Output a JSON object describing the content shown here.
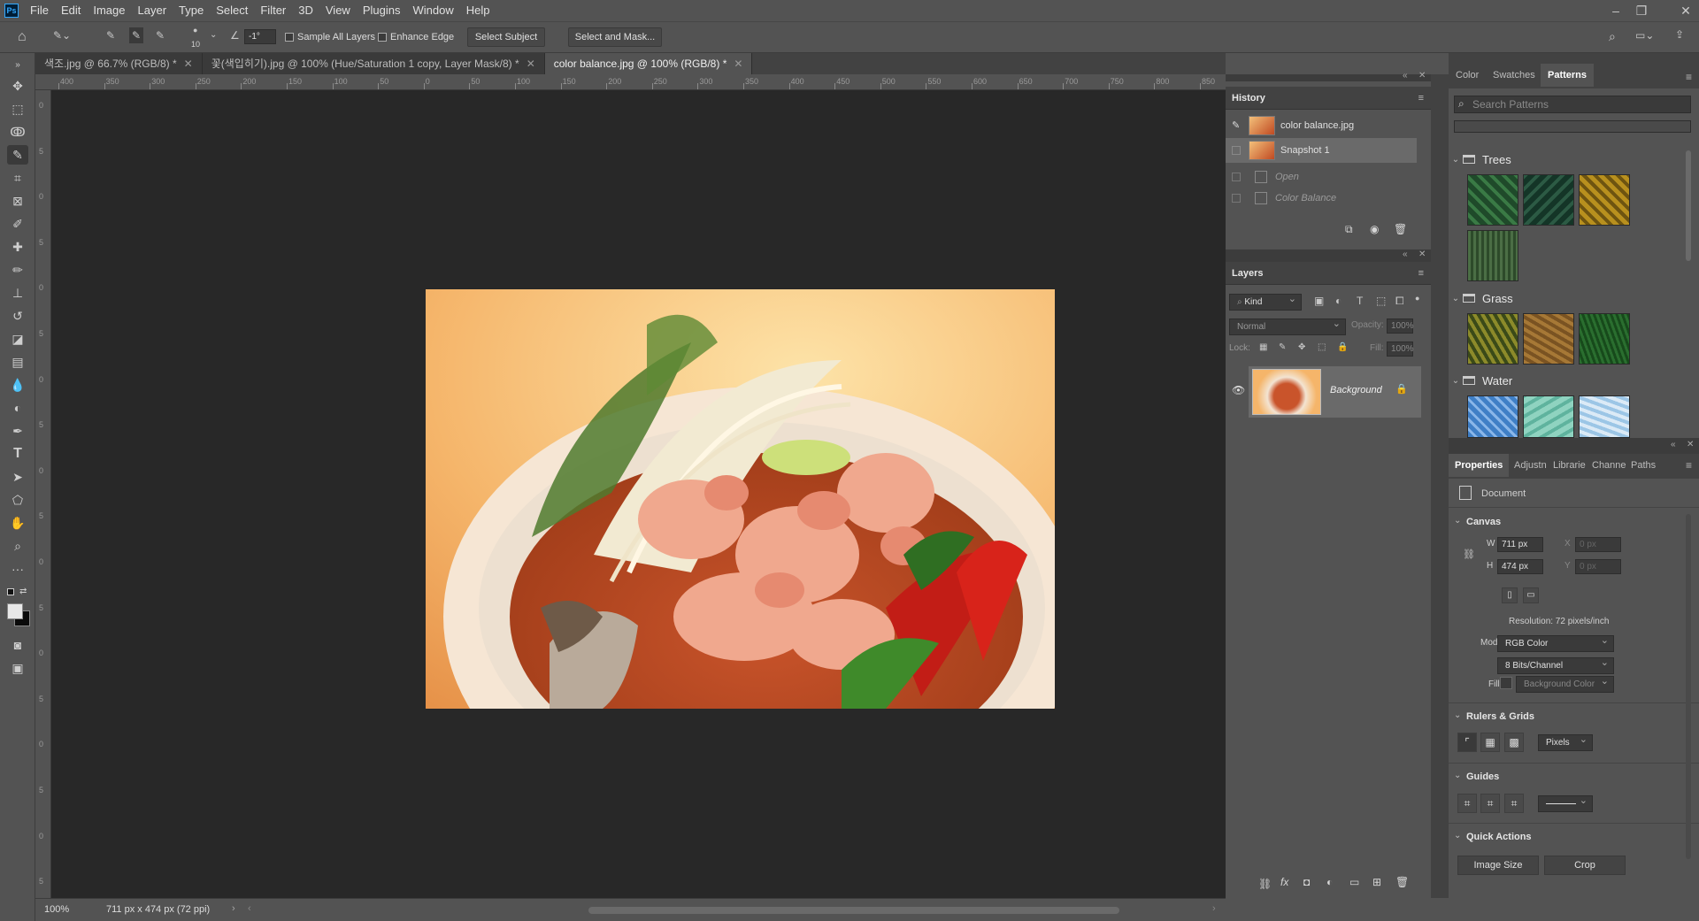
{
  "app": {
    "logo": "Ps"
  },
  "menu": [
    "File",
    "Edit",
    "Image",
    "Layer",
    "Type",
    "Select",
    "Filter",
    "3D",
    "View",
    "Plugins",
    "Window",
    "Help"
  ],
  "options": {
    "brush_size": "10",
    "angle": "-1°",
    "sample_all_layers": "Sample All Layers",
    "enhance_edge": "Enhance Edge",
    "select_subject": "Select Subject",
    "select_and_mask": "Select and Mask..."
  },
  "tabs": [
    {
      "label": "색조.jpg @ 66.7% (RGB/8) *"
    },
    {
      "label": "꽃(색입히기).jpg @ 100% (Hue/Saturation 1 copy, Layer Mask/8) *"
    },
    {
      "label": "color balance.jpg @ 100% (RGB/8) *"
    }
  ],
  "ruler_h": [
    "400",
    "350",
    "300",
    "250",
    "200",
    "150",
    "100",
    "50",
    "0",
    "50",
    "100",
    "150",
    "200",
    "250",
    "300",
    "350",
    "400",
    "450",
    "500",
    "550",
    "600",
    "650",
    "700",
    "750",
    "800",
    "850"
  ],
  "ruler_v": [
    "0",
    "5",
    "0",
    "5",
    "0",
    "5",
    "0",
    "5",
    "0",
    "5",
    "0",
    "5",
    "0",
    "5",
    "0",
    "5",
    "0",
    "5",
    "0"
  ],
  "status": {
    "zoom": "100%",
    "doc_info": "711 px x 474 px (72 ppi)"
  },
  "history": {
    "title": "History",
    "items": [
      {
        "label": "color balance.jpg"
      },
      {
        "label": "Snapshot 1"
      },
      {
        "label": "Open"
      },
      {
        "label": "Color Balance"
      }
    ]
  },
  "layers": {
    "title": "Layers",
    "kind": "Kind",
    "blend": "Normal",
    "opacity_label": "Opacity:",
    "opacity": "100%",
    "lock_label": "Lock:",
    "fill_label": "Fill:",
    "fill": "100%",
    "items": [
      {
        "name": "Background"
      }
    ]
  },
  "patterns_panel": {
    "tabs": [
      "Color",
      "Swatches",
      "Patterns"
    ],
    "search_placeholder": "Search Patterns",
    "groups": [
      {
        "name": "Trees",
        "tiles": [
          "#1f4a2a",
          "#143527",
          "#b8901e",
          "#4b6e45"
        ]
      },
      {
        "name": "Grass",
        "tiles": [
          "#8c8a2a",
          "#a67836",
          "#2a6e2f"
        ]
      },
      {
        "name": "Water",
        "tiles": [
          "#3f7fc6",
          "#8fd3c0",
          "#9cc6e6"
        ]
      }
    ]
  },
  "properties": {
    "tabs": [
      "Properties",
      "Adjustn",
      "Librarie",
      "Channe",
      "Paths"
    ],
    "document_label": "Document",
    "canvas_label": "Canvas",
    "w_label": "W",
    "w_value": "711 px",
    "h_label": "H",
    "h_value": "474 px",
    "x_label": "X",
    "x_value": "0 px",
    "y_label": "Y",
    "y_value": "0 px",
    "resolution": "Resolution: 72 pixels/inch",
    "mode_label": "Mode",
    "mode": "RGB Color",
    "bits": "8 Bits/Channel",
    "fill_label": "Fill",
    "fill_value": "Background Color",
    "rulers_label": "Rulers & Grids",
    "units": "Pixels",
    "guides_label": "Guides",
    "quick_actions_label": "Quick Actions",
    "image_size": "Image Size",
    "crop": "Crop"
  }
}
